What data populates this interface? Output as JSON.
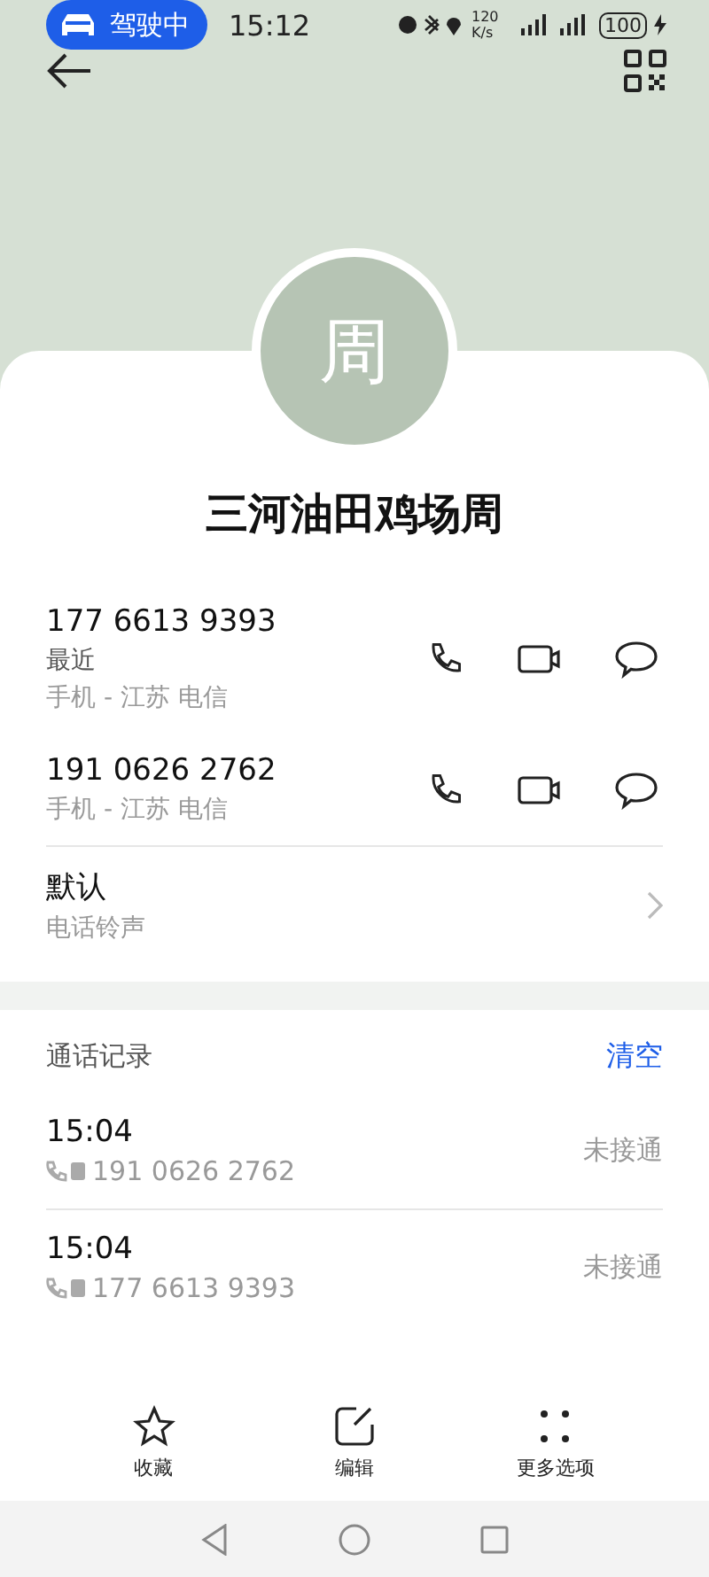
{
  "status_bar": {
    "driving_badge": "驾驶中",
    "time": "15:12",
    "net_speed": "120 K/s",
    "battery": "100"
  },
  "contact": {
    "avatar_letter": "周",
    "name": "三河油田鸡场周"
  },
  "numbers": [
    {
      "number": "177 6613 9393",
      "tag": "最近",
      "location": "手机 - 江苏 电信"
    },
    {
      "number": "191 0626 2762",
      "location": "手机 - 江苏 电信"
    }
  ],
  "ringtone": {
    "title": "默认",
    "subtitle": "电话铃声"
  },
  "call_log": {
    "title": "通话记录",
    "clear": "清空",
    "entries": [
      {
        "time": "15:04",
        "number": "191 0626 2762",
        "status": "未接通"
      },
      {
        "time": "15:04",
        "number": "177 6613 9393",
        "status": "未接通"
      }
    ]
  },
  "actions": [
    {
      "kind": "star",
      "label": "收藏"
    },
    {
      "kind": "edit",
      "label": "编辑"
    },
    {
      "kind": "more",
      "label": "更多选项"
    }
  ]
}
